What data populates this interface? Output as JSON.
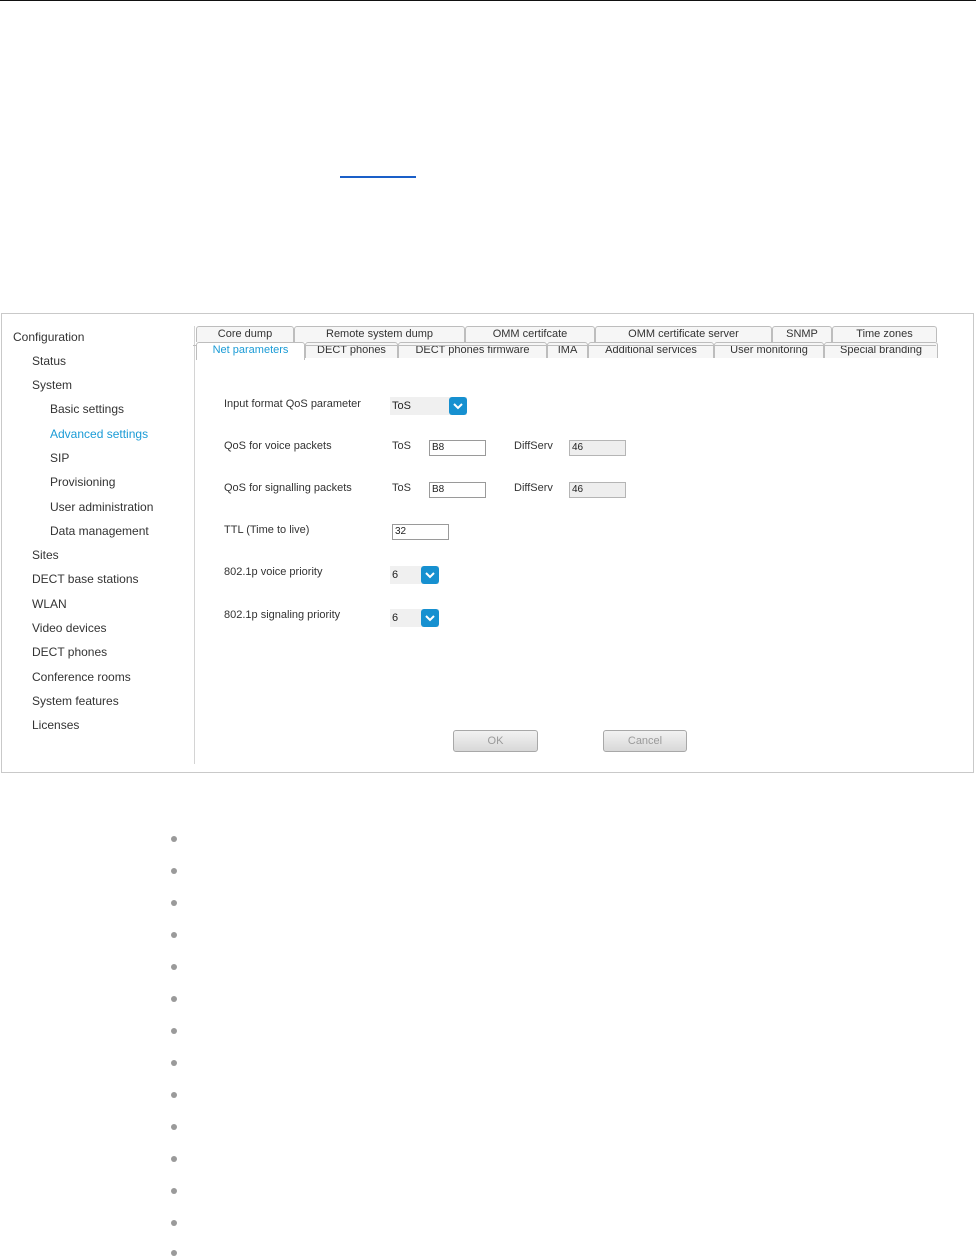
{
  "colors": {
    "accent": "#1a9bd6",
    "select_chevron": "#1690d0",
    "link": "#1a5fc8"
  },
  "sidebar": {
    "items": [
      {
        "label": "Configuration",
        "level": 0,
        "active": false
      },
      {
        "label": "Status",
        "level": 1,
        "active": false
      },
      {
        "label": "System",
        "level": 1,
        "active": false
      },
      {
        "label": "Basic settings",
        "level": 2,
        "active": false
      },
      {
        "label": "Advanced settings",
        "level": 2,
        "active": true
      },
      {
        "label": "SIP",
        "level": 2,
        "active": false
      },
      {
        "label": "Provisioning",
        "level": 2,
        "active": false
      },
      {
        "label": "User administration",
        "level": 2,
        "active": false
      },
      {
        "label": "Data management",
        "level": 2,
        "active": false
      },
      {
        "label": "Sites",
        "level": 1,
        "active": false
      },
      {
        "label": "DECT base stations",
        "level": 1,
        "active": false
      },
      {
        "label": "WLAN",
        "level": 1,
        "active": false
      },
      {
        "label": "Video devices",
        "level": 1,
        "active": false
      },
      {
        "label": "DECT phones",
        "level": 1,
        "active": false
      },
      {
        "label": "Conference rooms",
        "level": 1,
        "active": false
      },
      {
        "label": "System features",
        "level": 1,
        "active": false
      },
      {
        "label": "Licenses",
        "level": 1,
        "active": false
      }
    ]
  },
  "tabs": {
    "row_back": [
      "Core dump",
      "Remote system dump",
      "OMM certifcate",
      "OMM certificate server",
      "SNMP",
      "Time zones"
    ],
    "row_front": [
      "Net parameters",
      "DECT phones",
      "DECT phones firmware",
      "IMA",
      "Additional services",
      "User monitoring",
      "Special branding"
    ],
    "active": "Net parameters"
  },
  "form": {
    "input_format": {
      "label": "Input format QoS parameter",
      "value": "ToS"
    },
    "voice": {
      "label": "QoS for voice packets",
      "tos_label": "ToS",
      "tos_value": "B8",
      "diffserv_label": "DiffServ",
      "diffserv_value": "46"
    },
    "signalling": {
      "label": "QoS for signalling packets",
      "tos_label": "ToS",
      "tos_value": "B8",
      "diffserv_label": "DiffServ",
      "diffserv_value": "46"
    },
    "ttl": {
      "label": "TTL (Time to live)",
      "value": "32"
    },
    "voice_priority": {
      "label": "802.1p voice priority",
      "value": "6"
    },
    "signaling_priority": {
      "label": "802.1p signaling priority",
      "value": "6"
    }
  },
  "buttons": {
    "ok": "OK",
    "cancel": "Cancel"
  },
  "bullets_count_visible": 14
}
